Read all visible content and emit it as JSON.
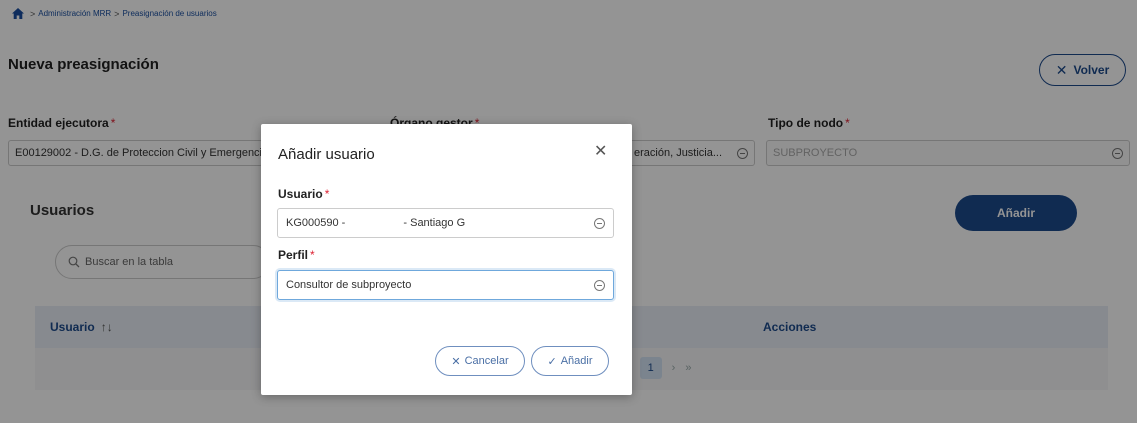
{
  "breadcrumb": {
    "items": [
      "Administración MRR",
      "Preasignación de usuarios"
    ],
    "separator": ">"
  },
  "page": {
    "title": "Nueva preasignación",
    "back_label": "Volver",
    "back_icon": "✕"
  },
  "fields": {
    "entidad": {
      "label": "Entidad ejecutora",
      "value": "E00129002 - D.G. de Proteccion Civil y Emergencias"
    },
    "organo": {
      "label": "Órgano gestor",
      "value": "eración, Justicia..."
    },
    "tipo": {
      "label": "Tipo de nodo",
      "value": "SUBPROYECTO"
    },
    "required_mark": "*"
  },
  "usuarios": {
    "title": "Usuarios",
    "add_label": "Añadir",
    "search_placeholder": "Buscar en la tabla",
    "columns": {
      "user": "Usuario",
      "actions": "Acciones"
    },
    "sort_icon": "↑↓",
    "pager": {
      "prev": "‹",
      "current": "1",
      "next": "›",
      "last": "»"
    }
  },
  "modal": {
    "title": "Añadir usuario",
    "close_icon": "✕",
    "usuario_label": "Usuario",
    "usuario_value": "KG000590 -                   - Santiago G",
    "perfil_label": "Perfil",
    "perfil_value": "Consultor de subproyecto",
    "cancel_label": "Cancelar",
    "cancel_icon": "✕",
    "add_label": "Añadir",
    "add_icon": "✓"
  },
  "colors": {
    "primary": "#1d4a8c",
    "required": "#dd2233",
    "focus": "#6fa8dc"
  }
}
